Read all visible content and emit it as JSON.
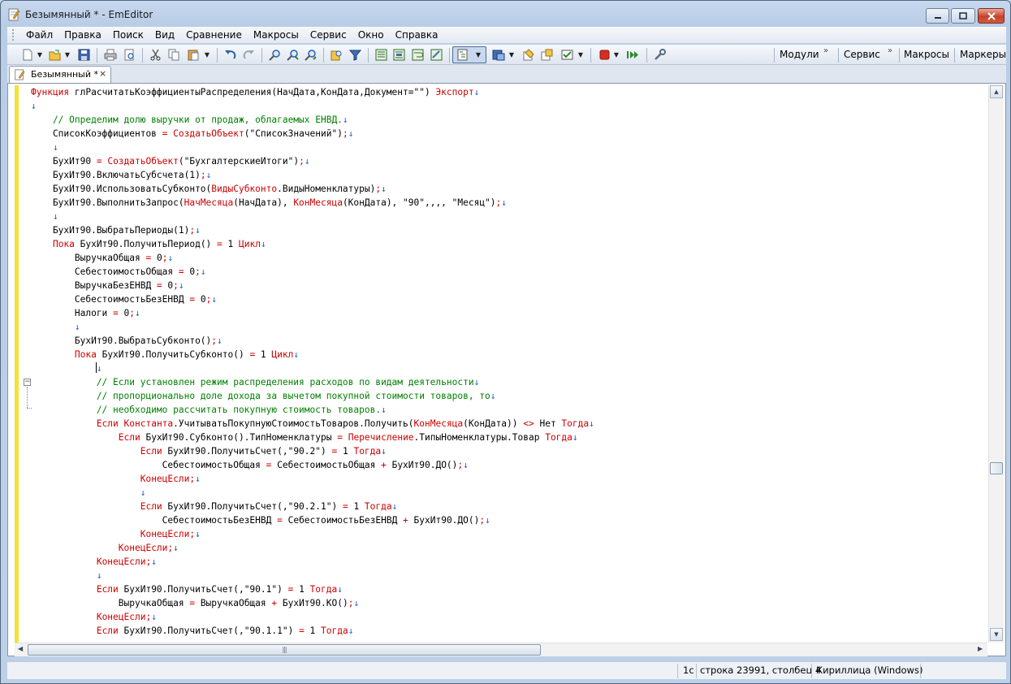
{
  "window": {
    "title": "Безымянный * - EmEditor"
  },
  "menu": [
    {
      "label": "Файл"
    },
    {
      "label": "Правка"
    },
    {
      "label": "Поиск"
    },
    {
      "label": "Вид"
    },
    {
      "label": "Сравнение"
    },
    {
      "label": "Макросы"
    },
    {
      "label": "Сервис"
    },
    {
      "label": "Окно"
    },
    {
      "label": "Справка"
    }
  ],
  "toolbar": {
    "panels": [
      {
        "label": "Модули"
      },
      {
        "label": "Сервис"
      },
      {
        "label": "Макросы"
      },
      {
        "label": "Маркеры"
      }
    ]
  },
  "tabs": [
    {
      "label": "Безымянный *",
      "close_glyph": "×"
    }
  ],
  "editor": {
    "lines": [
      [
        {
          "t": "Функция",
          "c": "kw"
        },
        {
          "t": " глРасчитатьКоэффициентыРаспределения(НачДата,КонДата,Документ=\"\") "
        },
        {
          "t": "Экспорт",
          "c": "kw"
        },
        {
          "t": "↓",
          "c": "nl"
        }
      ],
      [
        {
          "t": "↓",
          "c": "nl"
        }
      ],
      [
        {
          "t": "    // Определим долю выручки от продаж, облагаемых ЕНВД.",
          "c": "cm"
        },
        {
          "t": "↓",
          "c": "nl"
        }
      ],
      [
        {
          "t": "    СписокКоэффициентов "
        },
        {
          "t": "=",
          "c": "op"
        },
        {
          "t": " "
        },
        {
          "t": "СоздатьОбъект",
          "c": "kw"
        },
        {
          "t": "(\"СписокЗначений\")"
        },
        {
          "t": ";",
          "c": "op"
        },
        {
          "t": "↓",
          "c": "nl"
        }
      ],
      [
        {
          "t": "    "
        },
        {
          "t": "↓",
          "c": "nl"
        }
      ],
      [
        {
          "t": "    БухИт90 "
        },
        {
          "t": "=",
          "c": "op"
        },
        {
          "t": " "
        },
        {
          "t": "СоздатьОбъект",
          "c": "kw"
        },
        {
          "t": "(\"БухгалтерскиеИтоги\")"
        },
        {
          "t": ";",
          "c": "op"
        },
        {
          "t": "↓",
          "c": "nl"
        }
      ],
      [
        {
          "t": "    БухИт90.ВключатьСубсчета(1)"
        },
        {
          "t": ";",
          "c": "op"
        },
        {
          "t": "↓",
          "c": "nl"
        }
      ],
      [
        {
          "t": "    БухИт90.ИспользоватьСубконто("
        },
        {
          "t": "ВидыСубконто",
          "c": "kw"
        },
        {
          "t": ".ВидыНоменклатуры)"
        },
        {
          "t": ";",
          "c": "op"
        },
        {
          "t": "↓",
          "c": "nl"
        }
      ],
      [
        {
          "t": "    БухИт90.ВыполнитьЗапрос("
        },
        {
          "t": "НачМесяца",
          "c": "kw"
        },
        {
          "t": "(НачДата), "
        },
        {
          "t": "КонМесяца",
          "c": "kw"
        },
        {
          "t": "(КонДата), \"90\",,,, \"Месяц\")"
        },
        {
          "t": ";",
          "c": "op"
        },
        {
          "t": "↓",
          "c": "nl"
        }
      ],
      [
        {
          "t": "    "
        },
        {
          "t": "↓",
          "c": "nl"
        }
      ],
      [
        {
          "t": "    БухИт90.ВыбратьПериоды(1)"
        },
        {
          "t": ";",
          "c": "op"
        },
        {
          "t": "↓",
          "c": "nl"
        }
      ],
      [
        {
          "t": "    "
        },
        {
          "t": "Пока",
          "c": "kw"
        },
        {
          "t": " БухИт90.ПолучитьПериод() "
        },
        {
          "t": "=",
          "c": "op"
        },
        {
          "t": " 1 "
        },
        {
          "t": "Цикл",
          "c": "kw"
        },
        {
          "t": "↓",
          "c": "nl"
        }
      ],
      [
        {
          "t": "        ВыручкаОбщая "
        },
        {
          "t": "=",
          "c": "op"
        },
        {
          "t": " 0"
        },
        {
          "t": ";",
          "c": "op"
        },
        {
          "t": "↓",
          "c": "nl"
        }
      ],
      [
        {
          "t": "        СебестоимостьОбщая "
        },
        {
          "t": "=",
          "c": "op"
        },
        {
          "t": " 0"
        },
        {
          "t": ";",
          "c": "op"
        },
        {
          "t": "↓",
          "c": "nl"
        }
      ],
      [
        {
          "t": "        ВыручкаБезЕНВД "
        },
        {
          "t": "=",
          "c": "op"
        },
        {
          "t": " 0"
        },
        {
          "t": ";",
          "c": "op"
        },
        {
          "t": "↓",
          "c": "nl"
        }
      ],
      [
        {
          "t": "        СебестоимостьБезЕНВД "
        },
        {
          "t": "=",
          "c": "op"
        },
        {
          "t": " 0"
        },
        {
          "t": ";",
          "c": "op"
        },
        {
          "t": "↓",
          "c": "nl"
        }
      ],
      [
        {
          "t": "        Налоги "
        },
        {
          "t": "=",
          "c": "op"
        },
        {
          "t": " 0"
        },
        {
          "t": ";",
          "c": "op"
        },
        {
          "t": "↓",
          "c": "nl"
        }
      ],
      [
        {
          "t": "        "
        },
        {
          "t": "↓",
          "c": "nl"
        }
      ],
      [
        {
          "t": "        БухИт90.ВыбратьСубконто()"
        },
        {
          "t": ";",
          "c": "op"
        },
        {
          "t": "↓",
          "c": "nl"
        }
      ],
      [
        {
          "t": "        "
        },
        {
          "t": "Пока",
          "c": "kw"
        },
        {
          "t": " БухИт90.ПолучитьСубконто() "
        },
        {
          "t": "=",
          "c": "op"
        },
        {
          "t": " 1 "
        },
        {
          "t": "Цикл",
          "c": "kw"
        },
        {
          "t": "↓",
          "c": "nl"
        }
      ],
      [
        {
          "t": "            "
        },
        {
          "t": "",
          "c": "caret"
        },
        {
          "t": "↓",
          "c": "nl"
        }
      ],
      [
        {
          "t": "            // Если установлен режим распределения расходов по видам деятельности",
          "c": "cm"
        },
        {
          "t": "↓",
          "c": "nl"
        }
      ],
      [
        {
          "t": "            // пропорционально доле дохода за вычетом покупной стоимости товаров, то",
          "c": "cm"
        },
        {
          "t": "↓",
          "c": "nl"
        }
      ],
      [
        {
          "t": "            // необходимо рассчитать покупную стоимость товаров.",
          "c": "cm"
        },
        {
          "t": "↓",
          "c": "nl"
        }
      ],
      [
        {
          "t": "            "
        },
        {
          "t": "Если",
          "c": "kw"
        },
        {
          "t": " "
        },
        {
          "t": "Константа",
          "c": "kw"
        },
        {
          "t": ".УчитыватьПокупнуюСтоимостьТоваров.Получить("
        },
        {
          "t": "КонМесяца",
          "c": "kw"
        },
        {
          "t": "(КонДата)) "
        },
        {
          "t": "<>",
          "c": "op"
        },
        {
          "t": " Нет "
        },
        {
          "t": "Тогда",
          "c": "kw"
        },
        {
          "t": "↓",
          "c": "nl"
        }
      ],
      [
        {
          "t": "                "
        },
        {
          "t": "Если",
          "c": "kw"
        },
        {
          "t": " БухИт90.Субконто().ТипНоменклатуры "
        },
        {
          "t": "=",
          "c": "op"
        },
        {
          "t": " "
        },
        {
          "t": "Перечисление",
          "c": "kw"
        },
        {
          "t": ".ТипыНоменклатуры.Товар "
        },
        {
          "t": "Тогда",
          "c": "kw"
        },
        {
          "t": "↓",
          "c": "nl"
        }
      ],
      [
        {
          "t": "                    "
        },
        {
          "t": "Если",
          "c": "kw"
        },
        {
          "t": " БухИт90.ПолучитьСчет(,\"90.2\") "
        },
        {
          "t": "=",
          "c": "op"
        },
        {
          "t": " 1 "
        },
        {
          "t": "Тогда",
          "c": "kw"
        },
        {
          "t": "↓",
          "c": "nl"
        }
      ],
      [
        {
          "t": "                        СебестоимостьОбщая "
        },
        {
          "t": "=",
          "c": "op"
        },
        {
          "t": " СебестоимостьОбщая "
        },
        {
          "t": "+",
          "c": "op"
        },
        {
          "t": " БухИт90.ДО()"
        },
        {
          "t": ";",
          "c": "op"
        },
        {
          "t": "↓",
          "c": "nl"
        }
      ],
      [
        {
          "t": "                    "
        },
        {
          "t": "КонецЕсли",
          "c": "kw"
        },
        {
          "t": ";",
          "c": "op"
        },
        {
          "t": "↓",
          "c": "nl"
        }
      ],
      [
        {
          "t": "                    "
        },
        {
          "t": "↓",
          "c": "nl"
        }
      ],
      [
        {
          "t": "                    "
        },
        {
          "t": "Если",
          "c": "kw"
        },
        {
          "t": " БухИт90.ПолучитьСчет(,\"90.2.1\") "
        },
        {
          "t": "=",
          "c": "op"
        },
        {
          "t": " 1 "
        },
        {
          "t": "Тогда",
          "c": "kw"
        },
        {
          "t": "↓",
          "c": "nl"
        }
      ],
      [
        {
          "t": "                        СебестоимостьБезЕНВД "
        },
        {
          "t": "=",
          "c": "op"
        },
        {
          "t": " СебестоимостьБезЕНВД "
        },
        {
          "t": "+",
          "c": "op"
        },
        {
          "t": " БухИт90.ДО()"
        },
        {
          "t": ";",
          "c": "op"
        },
        {
          "t": "↓",
          "c": "nl"
        }
      ],
      [
        {
          "t": "                    "
        },
        {
          "t": "КонецЕсли",
          "c": "kw"
        },
        {
          "t": ";",
          "c": "op"
        },
        {
          "t": "↓",
          "c": "nl"
        }
      ],
      [
        {
          "t": "                "
        },
        {
          "t": "КонецЕсли",
          "c": "kw"
        },
        {
          "t": ";",
          "c": "op"
        },
        {
          "t": "↓",
          "c": "nl"
        }
      ],
      [
        {
          "t": "            "
        },
        {
          "t": "КонецЕсли",
          "c": "kw"
        },
        {
          "t": ";",
          "c": "op"
        },
        {
          "t": "↓",
          "c": "nl"
        }
      ],
      [
        {
          "t": "            "
        },
        {
          "t": "↓",
          "c": "nl"
        }
      ],
      [
        {
          "t": "            "
        },
        {
          "t": "Если",
          "c": "kw"
        },
        {
          "t": " БухИт90.ПолучитьСчет(,\"90.1\") "
        },
        {
          "t": "=",
          "c": "op"
        },
        {
          "t": " 1 "
        },
        {
          "t": "Тогда",
          "c": "kw"
        },
        {
          "t": "↓",
          "c": "nl"
        }
      ],
      [
        {
          "t": "                ВыручкаОбщая "
        },
        {
          "t": "=",
          "c": "op"
        },
        {
          "t": " ВыручкаОбщая "
        },
        {
          "t": "+",
          "c": "op"
        },
        {
          "t": " БухИт90.КО()"
        },
        {
          "t": ";",
          "c": "op"
        },
        {
          "t": "↓",
          "c": "nl"
        }
      ],
      [
        {
          "t": "            "
        },
        {
          "t": "КонецЕсли",
          "c": "kw"
        },
        {
          "t": ";",
          "c": "op"
        },
        {
          "t": "↓",
          "c": "nl"
        }
      ],
      [
        {
          "t": "            "
        },
        {
          "t": "Если",
          "c": "kw"
        },
        {
          "t": " БухИт90.ПолучитьСчет(,\"90.1.1\") "
        },
        {
          "t": "=",
          "c": "op"
        },
        {
          "t": " 1 "
        },
        {
          "t": "Тогда",
          "c": "kw"
        },
        {
          "t": "↓",
          "c": "nl"
        }
      ]
    ]
  },
  "statusbar": {
    "mode": "1c",
    "position": "строка 23991, столбец 4",
    "encoding": "Кириллица (Windows)"
  },
  "colors": {
    "keyword": "#cc0000",
    "comment": "#008000",
    "newline_mark": "#1e64c8",
    "modified_gutter": "#f2e23a"
  }
}
